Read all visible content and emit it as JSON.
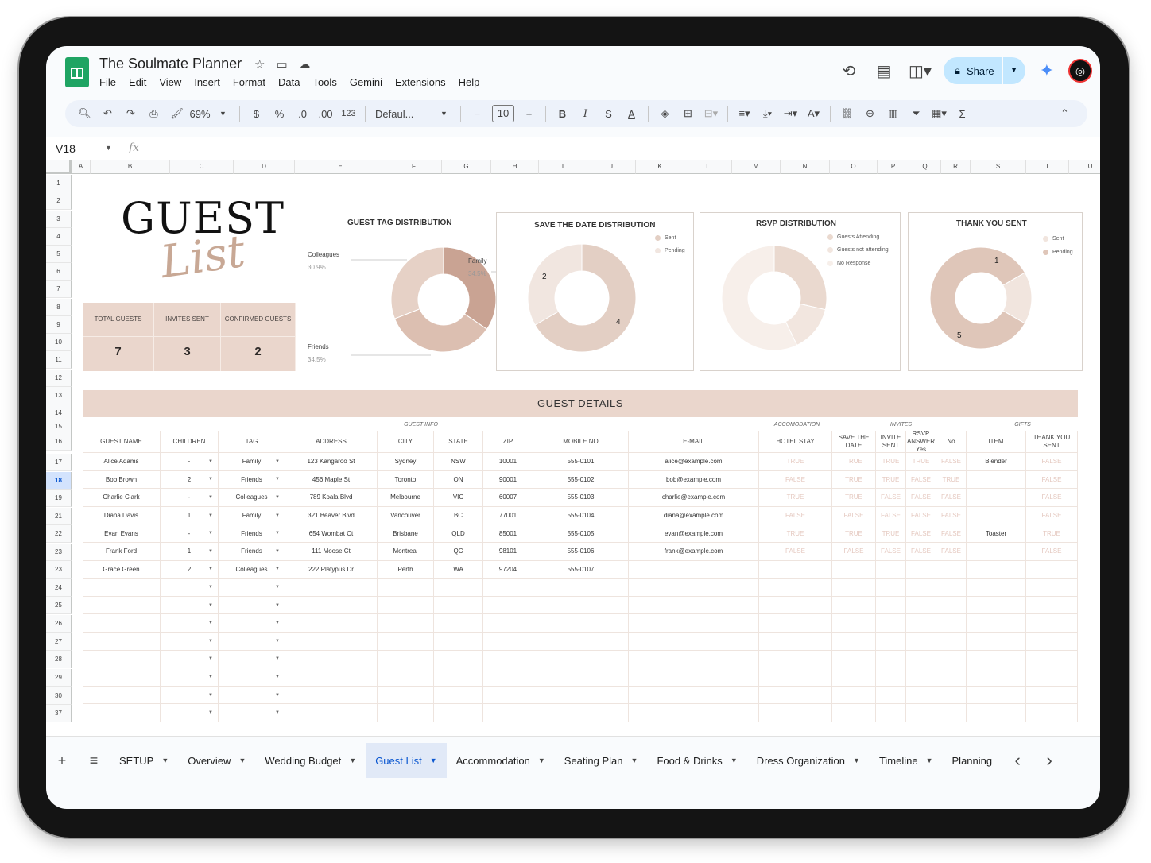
{
  "app": {
    "title": "The Soulmate Planner",
    "menu": [
      "File",
      "Edit",
      "View",
      "Insert",
      "Format",
      "Data",
      "Tools",
      "Gemini",
      "Extensions",
      "Help"
    ],
    "share_label": "Share"
  },
  "toolbar": {
    "zoom": "69%",
    "currency": "$",
    "percent": "%",
    "dec_dec": ".0",
    "dec_inc": ".00",
    "number_format": "123",
    "font": "Defaul...",
    "font_size": "10"
  },
  "formula_bar": {
    "cell_ref": "V18",
    "fx": "fx"
  },
  "columns": [
    "A",
    "B",
    "C",
    "D",
    "E",
    "F",
    "G",
    "H",
    "I",
    "J",
    "K",
    "L",
    "M",
    "N",
    "O",
    "P",
    "Q",
    "R",
    "S",
    "T",
    "U"
  ],
  "row_numbers": [
    "1",
    "2",
    "3",
    "4",
    "5",
    "6",
    "7",
    "8",
    "9",
    "10",
    "11",
    "12",
    "13",
    "14",
    "15",
    "16",
    "17",
    "18",
    "19",
    "21",
    "22",
    "23",
    "23",
    "24",
    "25",
    "26",
    "27",
    "28",
    "29",
    "30",
    "37"
  ],
  "heading": {
    "title": "GUEST",
    "script": "List"
  },
  "stats": [
    {
      "label": "TOTAL GUESTS",
      "value": "7"
    },
    {
      "label": "INVITES SENT",
      "value": "3"
    },
    {
      "label": "CONFIRMED GUESTS",
      "value": "2"
    }
  ],
  "chart_data": [
    {
      "type": "pie",
      "title": "GUEST TAG DISTRIBUTION",
      "labels": [
        "Family",
        "Friends",
        "Colleagues"
      ],
      "values": [
        34.5,
        34.5,
        30.9
      ],
      "value_labels": [
        "34.5%",
        "34.5%",
        "30.9%"
      ],
      "colors": [
        "#c9a393",
        "#dcbfb1",
        "#e6d1c6"
      ]
    },
    {
      "type": "pie",
      "title": "SAVE THE DATE DISTRIBUTION",
      "labels": [
        "Sent",
        "Pending"
      ],
      "values": [
        4,
        2
      ],
      "value_labels": [
        "4",
        "2"
      ],
      "colors": [
        "#e3cfc4",
        "#f1e6e0"
      ]
    },
    {
      "type": "pie",
      "title": "RSVP DISTRIBUTION",
      "labels": [
        "Guests Attending",
        "Guests not attending",
        "No Response"
      ],
      "values": [
        2,
        1,
        4
      ],
      "colors": [
        "#ead9cf",
        "#f2e6df",
        "#f7efea"
      ]
    },
    {
      "type": "pie",
      "title": "THANK YOU SENT",
      "labels": [
        "Sent",
        "Pending"
      ],
      "values": [
        1,
        5
      ],
      "value_labels": [
        "1",
        "5"
      ],
      "colors": [
        "#f1e5de",
        "#dfc6b9"
      ]
    }
  ],
  "details": {
    "title": "GUEST DETAILS",
    "groups": [
      "GUEST INFO",
      "ACCOMODATION",
      "INVITES",
      "GIFTS"
    ],
    "headers": [
      "GUEST NAME",
      "CHILDREN",
      "TAG",
      "ADDRESS",
      "CITY",
      "STATE",
      "ZIP",
      "MOBILE NO",
      "E-MAIL",
      "HOTEL STAY",
      "SAVE THE DATE",
      "INVITE SENT",
      "RSVP ANSWER Yes",
      "No",
      "ITEM",
      "THANK YOU SENT"
    ],
    "rows": [
      [
        "Alice Adams",
        "-",
        "Family",
        "123 Kangaroo St",
        "Sydney",
        "NSW",
        "10001",
        "555-0101",
        "alice@example.com",
        "TRUE",
        "TRUE",
        "TRUE",
        "TRUE",
        "FALSE",
        "Blender",
        "FALSE"
      ],
      [
        "Bob Brown",
        "2",
        "Friends",
        "456 Maple St",
        "Toronto",
        "ON",
        "90001",
        "555-0102",
        "bob@example.com",
        "FALSE",
        "TRUE",
        "TRUE",
        "FALSE",
        "TRUE",
        "",
        "FALSE"
      ],
      [
        "Charlie Clark",
        "-",
        "Colleagues",
        "789 Koala Blvd",
        "Melbourne",
        "VIC",
        "60007",
        "555-0103",
        "charlie@example.com",
        "TRUE",
        "TRUE",
        "FALSE",
        "FALSE",
        "FALSE",
        "",
        "FALSE"
      ],
      [
        "Diana Davis",
        "1",
        "Family",
        "321 Beaver Blvd",
        "Vancouver",
        "BC",
        "77001",
        "555-0104",
        "diana@example.com",
        "FALSE",
        "FALSE",
        "FALSE",
        "FALSE",
        "FALSE",
        "",
        "FALSE"
      ],
      [
        "Evan Evans",
        "-",
        "Friends",
        "654 Wombat Ct",
        "Brisbane",
        "QLD",
        "85001",
        "555-0105",
        "evan@example.com",
        "TRUE",
        "TRUE",
        "TRUE",
        "FALSE",
        "FALSE",
        "Toaster",
        "TRUE"
      ],
      [
        "Frank Ford",
        "1",
        "Friends",
        "111 Moose Ct",
        "Montreal",
        "QC",
        "98101",
        "555-0106",
        "frank@example.com",
        "FALSE",
        "FALSE",
        "FALSE",
        "FALSE",
        "FALSE",
        "",
        "FALSE"
      ],
      [
        "Grace Green",
        "2",
        "Colleagues",
        "222 Platypus Dr",
        "Perth",
        "WA",
        "97204",
        "555-0107",
        "",
        "",
        "",
        "",
        "",
        "",
        "",
        ""
      ]
    ]
  },
  "sheet_tabs": [
    {
      "label": "SETUP",
      "active": false
    },
    {
      "label": "Overview",
      "active": false
    },
    {
      "label": "Wedding Budget",
      "active": false
    },
    {
      "label": "Guest List",
      "active": true
    },
    {
      "label": "Accommodation",
      "active": false
    },
    {
      "label": "Seating Plan",
      "active": false
    },
    {
      "label": "Food & Drinks",
      "active": false
    },
    {
      "label": "Dress Organization",
      "active": false
    },
    {
      "label": "Timeline",
      "active": false
    },
    {
      "label": "Planning",
      "active": false
    }
  ],
  "theme": {
    "accent": "#ead6cc",
    "selection": "#d3e3fd",
    "brand": "#1fa463"
  }
}
